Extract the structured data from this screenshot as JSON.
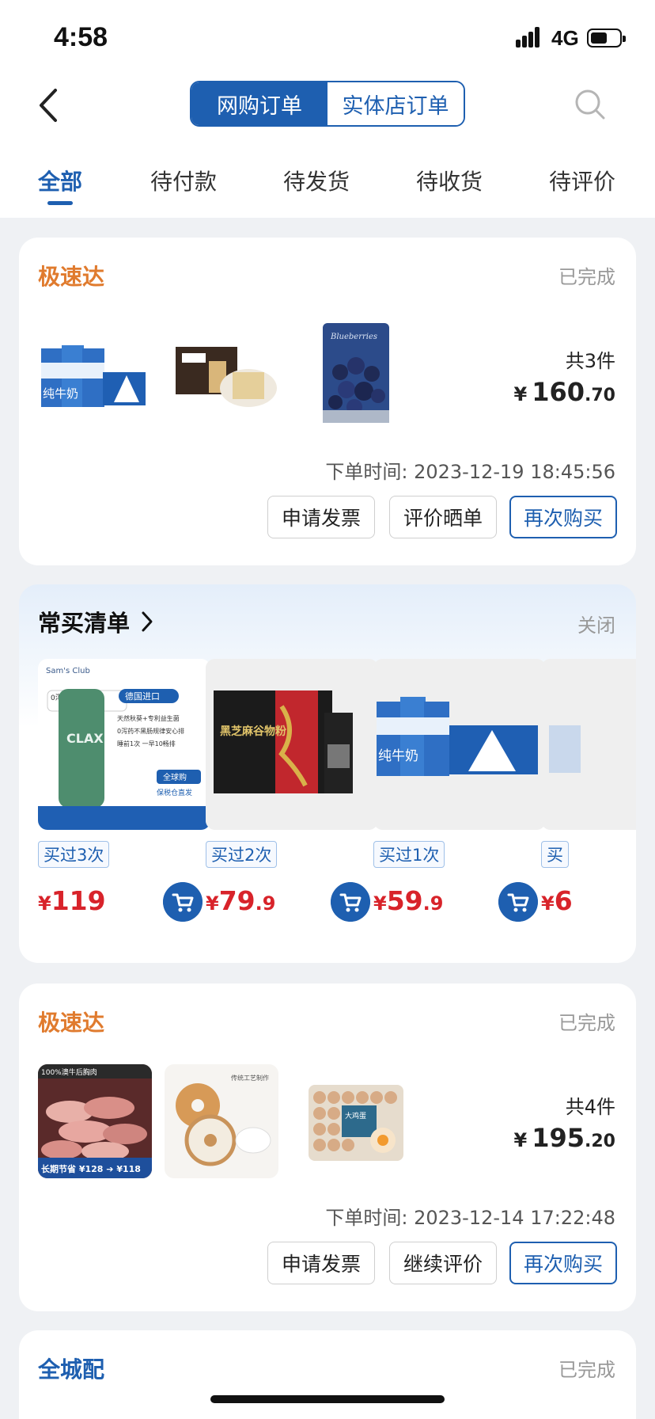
{
  "status_bar": {
    "time": "4:58",
    "network": "4G"
  },
  "header": {
    "back_icon": "back-chevron-icon",
    "tab_online": "网购订单",
    "tab_store": "实体店订单",
    "search_icon": "search-icon"
  },
  "order_tabs": [
    "全部",
    "待付款",
    "待发货",
    "待收货",
    "待评价"
  ],
  "orders": [
    {
      "shop": "极速达",
      "status": "已完成",
      "quantity": "共3件",
      "currency": "¥",
      "price_int": "160",
      "price_dec": ".70",
      "order_time": "下单时间: 2023-12-19 18:45:56",
      "buttons": [
        "申请发票",
        "评价晒单",
        "再次购买"
      ]
    },
    {
      "shop": "极速达",
      "status": "已完成",
      "quantity": "共4件",
      "currency": "¥",
      "price_int": "195",
      "price_dec": ".20",
      "order_time": "下单时间: 2023-12-14 17:22:48",
      "buttons": [
        "申请发票",
        "继续评价",
        "再次购买"
      ],
      "thumb_captions": {
        "meat_top": "100%澳牛后胸肉",
        "meat_bottom": "长期节省 ¥128 ➔ ¥118",
        "bagel_top": "传统工艺制作",
        "eggs_label": "大鸡蛋"
      }
    },
    {
      "shop": "全城配",
      "status": "已完成"
    }
  ],
  "frequent": {
    "title": "常买清单",
    "close": "关闭",
    "items": [
      {
        "badge": "买过3次",
        "currency": "¥",
        "price_int": "119",
        "price_dec": "",
        "img": {
          "brand": "Sam's Club",
          "origin": "德国进口",
          "label": "0泻药 不黑肠",
          "name": "CLAX",
          "bullets": [
            "天然秋葵+专利益生菌",
            "0泻药不黑肠规律安心排",
            "睡前1次 一早10畅排"
          ],
          "tag1": "全球购",
          "tag2": "保税仓直发"
        }
      },
      {
        "badge": "买过2次",
        "currency": "¥",
        "price_int": "79",
        "price_dec": ".9",
        "img": {
          "name": "黑芝麻谷物粉"
        }
      },
      {
        "badge": "买过1次",
        "currency": "¥",
        "price_int": "59",
        "price_dec": ".9",
        "img": {
          "name": "纯牛奶"
        }
      },
      {
        "badge": "买",
        "currency": "¥",
        "price_int": "6",
        "price_dec": ""
      }
    ]
  },
  "product_art": {
    "milk_text": "纯牛奶",
    "blueberry_text": "Blueberries"
  },
  "colors": {
    "brand_blue": "#1e5fb0",
    "orange": "#e07b2e",
    "price_red": "#d8232a"
  }
}
